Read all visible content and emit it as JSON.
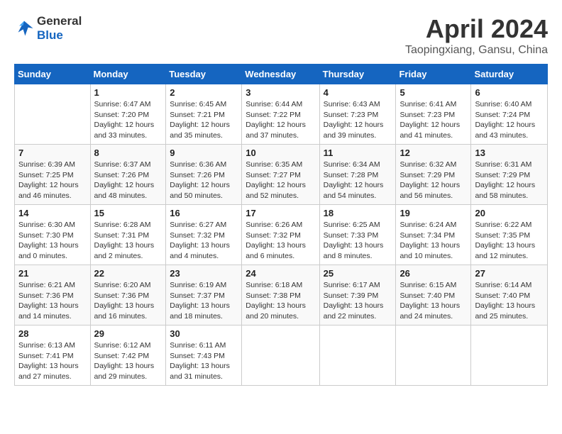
{
  "header": {
    "logo_line1": "General",
    "logo_line2": "Blue",
    "month": "April 2024",
    "location": "Taopingxiang, Gansu, China"
  },
  "weekdays": [
    "Sunday",
    "Monday",
    "Tuesday",
    "Wednesday",
    "Thursday",
    "Friday",
    "Saturday"
  ],
  "weeks": [
    [
      {
        "day": "",
        "info": ""
      },
      {
        "day": "1",
        "info": "Sunrise: 6:47 AM\nSunset: 7:20 PM\nDaylight: 12 hours\nand 33 minutes."
      },
      {
        "day": "2",
        "info": "Sunrise: 6:45 AM\nSunset: 7:21 PM\nDaylight: 12 hours\nand 35 minutes."
      },
      {
        "day": "3",
        "info": "Sunrise: 6:44 AM\nSunset: 7:22 PM\nDaylight: 12 hours\nand 37 minutes."
      },
      {
        "day": "4",
        "info": "Sunrise: 6:43 AM\nSunset: 7:23 PM\nDaylight: 12 hours\nand 39 minutes."
      },
      {
        "day": "5",
        "info": "Sunrise: 6:41 AM\nSunset: 7:23 PM\nDaylight: 12 hours\nand 41 minutes."
      },
      {
        "day": "6",
        "info": "Sunrise: 6:40 AM\nSunset: 7:24 PM\nDaylight: 12 hours\nand 43 minutes."
      }
    ],
    [
      {
        "day": "7",
        "info": "Sunrise: 6:39 AM\nSunset: 7:25 PM\nDaylight: 12 hours\nand 46 minutes."
      },
      {
        "day": "8",
        "info": "Sunrise: 6:37 AM\nSunset: 7:26 PM\nDaylight: 12 hours\nand 48 minutes."
      },
      {
        "day": "9",
        "info": "Sunrise: 6:36 AM\nSunset: 7:26 PM\nDaylight: 12 hours\nand 50 minutes."
      },
      {
        "day": "10",
        "info": "Sunrise: 6:35 AM\nSunset: 7:27 PM\nDaylight: 12 hours\nand 52 minutes."
      },
      {
        "day": "11",
        "info": "Sunrise: 6:34 AM\nSunset: 7:28 PM\nDaylight: 12 hours\nand 54 minutes."
      },
      {
        "day": "12",
        "info": "Sunrise: 6:32 AM\nSunset: 7:29 PM\nDaylight: 12 hours\nand 56 minutes."
      },
      {
        "day": "13",
        "info": "Sunrise: 6:31 AM\nSunset: 7:29 PM\nDaylight: 12 hours\nand 58 minutes."
      }
    ],
    [
      {
        "day": "14",
        "info": "Sunrise: 6:30 AM\nSunset: 7:30 PM\nDaylight: 13 hours\nand 0 minutes."
      },
      {
        "day": "15",
        "info": "Sunrise: 6:28 AM\nSunset: 7:31 PM\nDaylight: 13 hours\nand 2 minutes."
      },
      {
        "day": "16",
        "info": "Sunrise: 6:27 AM\nSunset: 7:32 PM\nDaylight: 13 hours\nand 4 minutes."
      },
      {
        "day": "17",
        "info": "Sunrise: 6:26 AM\nSunset: 7:32 PM\nDaylight: 13 hours\nand 6 minutes."
      },
      {
        "day": "18",
        "info": "Sunrise: 6:25 AM\nSunset: 7:33 PM\nDaylight: 13 hours\nand 8 minutes."
      },
      {
        "day": "19",
        "info": "Sunrise: 6:24 AM\nSunset: 7:34 PM\nDaylight: 13 hours\nand 10 minutes."
      },
      {
        "day": "20",
        "info": "Sunrise: 6:22 AM\nSunset: 7:35 PM\nDaylight: 13 hours\nand 12 minutes."
      }
    ],
    [
      {
        "day": "21",
        "info": "Sunrise: 6:21 AM\nSunset: 7:36 PM\nDaylight: 13 hours\nand 14 minutes."
      },
      {
        "day": "22",
        "info": "Sunrise: 6:20 AM\nSunset: 7:36 PM\nDaylight: 13 hours\nand 16 minutes."
      },
      {
        "day": "23",
        "info": "Sunrise: 6:19 AM\nSunset: 7:37 PM\nDaylight: 13 hours\nand 18 minutes."
      },
      {
        "day": "24",
        "info": "Sunrise: 6:18 AM\nSunset: 7:38 PM\nDaylight: 13 hours\nand 20 minutes."
      },
      {
        "day": "25",
        "info": "Sunrise: 6:17 AM\nSunset: 7:39 PM\nDaylight: 13 hours\nand 22 minutes."
      },
      {
        "day": "26",
        "info": "Sunrise: 6:15 AM\nSunset: 7:40 PM\nDaylight: 13 hours\nand 24 minutes."
      },
      {
        "day": "27",
        "info": "Sunrise: 6:14 AM\nSunset: 7:40 PM\nDaylight: 13 hours\nand 25 minutes."
      }
    ],
    [
      {
        "day": "28",
        "info": "Sunrise: 6:13 AM\nSunset: 7:41 PM\nDaylight: 13 hours\nand 27 minutes."
      },
      {
        "day": "29",
        "info": "Sunrise: 6:12 AM\nSunset: 7:42 PM\nDaylight: 13 hours\nand 29 minutes."
      },
      {
        "day": "30",
        "info": "Sunrise: 6:11 AM\nSunset: 7:43 PM\nDaylight: 13 hours\nand 31 minutes."
      },
      {
        "day": "",
        "info": ""
      },
      {
        "day": "",
        "info": ""
      },
      {
        "day": "",
        "info": ""
      },
      {
        "day": "",
        "info": ""
      }
    ]
  ]
}
